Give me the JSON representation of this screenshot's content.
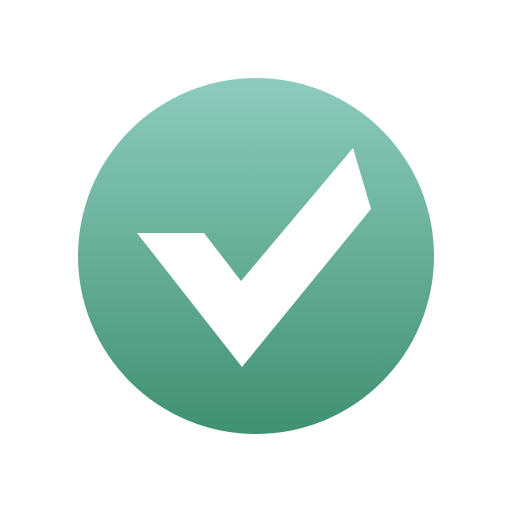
{
  "icon": {
    "name": "checkmark-circle-icon",
    "colors": {
      "gradient_top": "#8dcbbf",
      "gradient_bottom": "#3f9170",
      "check": "#ffffff",
      "background": "#ffffff"
    }
  }
}
